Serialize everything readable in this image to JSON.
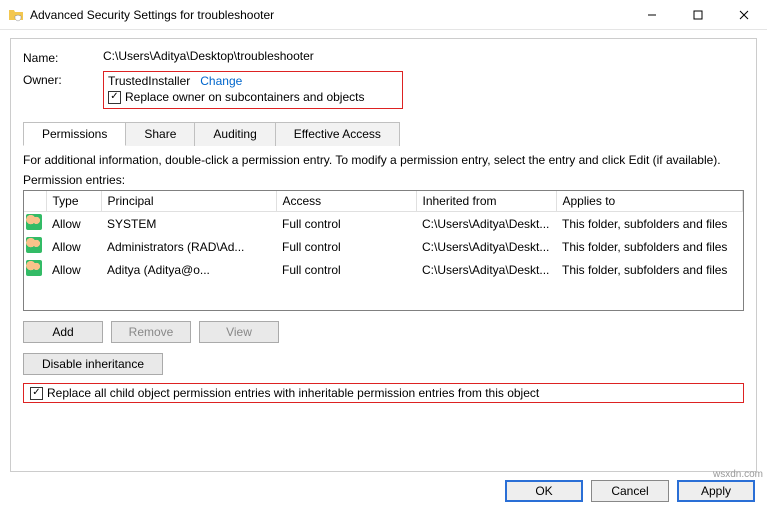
{
  "title": "Advanced Security Settings for troubleshooter",
  "nameLabel": "Name:",
  "nameValue": "C:\\Users\\Aditya\\Desktop\\troubleshooter",
  "ownerLabel": "Owner:",
  "ownerValue": "TrustedInstaller",
  "changeLink": "Change",
  "replaceOwnerLabel": "Replace owner on subcontainers and objects",
  "tabs": {
    "permissions": "Permissions",
    "share": "Share",
    "auditing": "Auditing",
    "effective": "Effective Access"
  },
  "infoText": "For additional information, double-click a permission entry. To modify a permission entry, select the entry and click Edit (if available).",
  "entriesLabel": "Permission entries:",
  "columns": {
    "type": "Type",
    "principal": "Principal",
    "access": "Access",
    "inherited": "Inherited from",
    "applies": "Applies to"
  },
  "rows": [
    {
      "type": "Allow",
      "principal": "SYSTEM",
      "access": "Full control",
      "inherited": "C:\\Users\\Aditya\\Deskt...",
      "applies": "This folder, subfolders and files"
    },
    {
      "type": "Allow",
      "principal": "Administrators (RAD\\Ad...",
      "access": "Full control",
      "inherited": "C:\\Users\\Aditya\\Deskt...",
      "applies": "This folder, subfolders and files"
    },
    {
      "type": "Allow",
      "principal": "Aditya (Aditya@o...",
      "access": "Full control",
      "inherited": "C:\\Users\\Aditya\\Deskt...",
      "applies": "This folder, subfolders and files"
    }
  ],
  "buttons": {
    "add": "Add",
    "remove": "Remove",
    "view": "View",
    "disable": "Disable inheritance",
    "ok": "OK",
    "cancel": "Cancel",
    "apply": "Apply"
  },
  "replaceChildLabel": "Replace all child object permission entries with inheritable permission entries from this object",
  "watermark": "wsxdn.com"
}
